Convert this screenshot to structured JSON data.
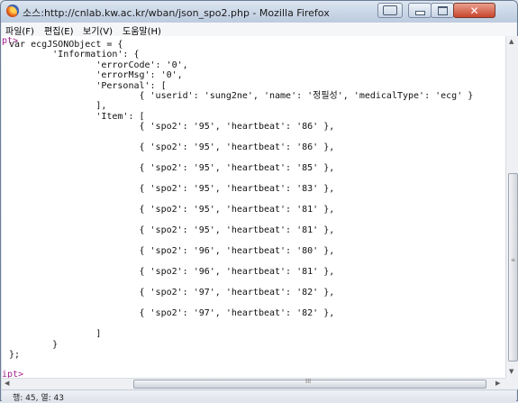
{
  "window": {
    "title": "소스:http://cnlab.kw.ac.kr/wban/json_spo2.php - Mozilla Firefox"
  },
  "menubar": {
    "items": [
      "파일(F)",
      "편집(E)",
      "보기(V)",
      "도움말(H)"
    ]
  },
  "source": {
    "top_marker": "pt>",
    "bottom_marker": "ipt>",
    "lines": [
      "var ecgJSONObject = {",
      "        'Information': {",
      "                'errorCode': '0',",
      "                'errorMsg': '0',",
      "                'Personal': [",
      "                        { 'userid': 'sung2ne', 'name': '정필성', 'medicalType': 'ecg' }",
      "                ],",
      "                'Item': [",
      "                        { 'spo2': '95', 'heartbeat': '86' },",
      "                        { 'spo2': '95', 'heartbeat': '86' },",
      "                        { 'spo2': '95', 'heartbeat': '85' },",
      "                        { 'spo2': '95', 'heartbeat': '83' },",
      "                        { 'spo2': '95', 'heartbeat': '81' },",
      "                        { 'spo2': '95', 'heartbeat': '81' },",
      "                        { 'spo2': '96', 'heartbeat': '80' },",
      "                        { 'spo2': '96', 'heartbeat': '81' },",
      "                        { 'spo2': '97', 'heartbeat': '82' },",
      "                        { 'spo2': '97', 'heartbeat': '82' },",
      "                ]",
      "        }",
      "};"
    ]
  },
  "scroll": {
    "vertical_position": 0.62,
    "horizontal_grip": "III"
  },
  "status": {
    "text": "행: 45, 열: 43"
  },
  "icons": {
    "app": "firefox-icon",
    "minimize": "minimize-icon",
    "maximize": "maximize-icon",
    "close": "close-icon"
  }
}
